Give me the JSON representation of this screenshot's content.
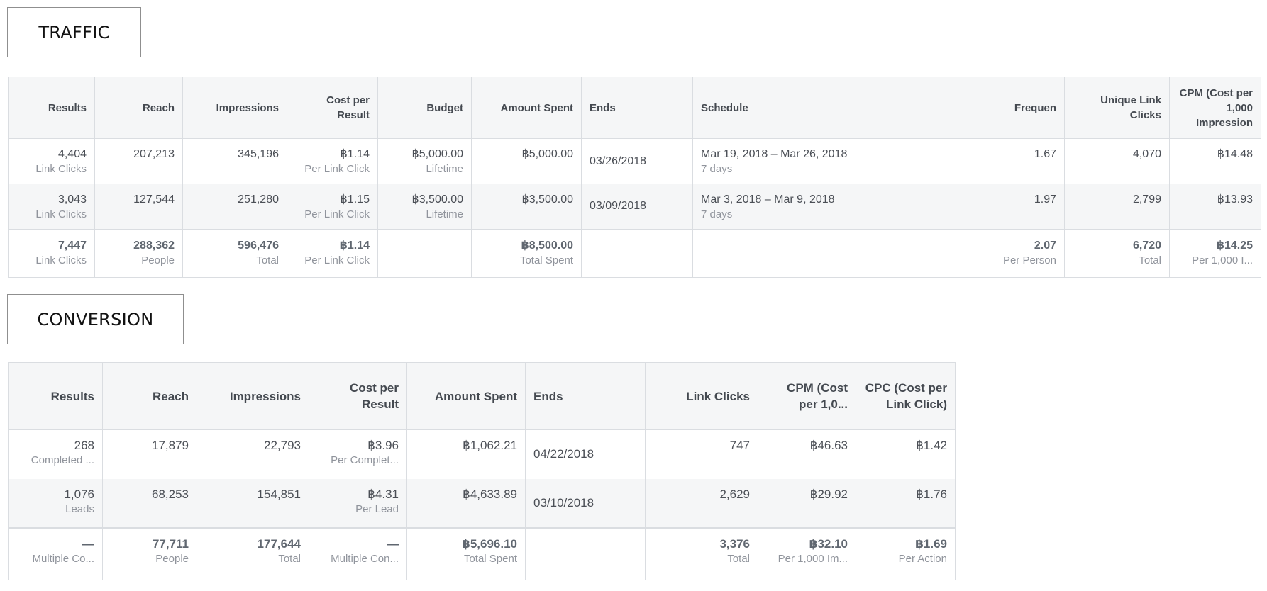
{
  "traffic": {
    "label": "TRAFFIC",
    "headers": [
      "Results",
      "Reach",
      "Impressions",
      "Cost per Result",
      "Budget",
      "Amount Spent",
      "Ends",
      "Schedule",
      "Frequen",
      "Unique Link Clicks",
      "CPM (Cost per 1,000 Impression"
    ],
    "rows": [
      {
        "results": "4,404",
        "results_sub": "Link Clicks",
        "reach": "207,213",
        "impressions": "345,196",
        "cost": "฿1.14",
        "cost_sub": "Per Link Click",
        "budget": "฿5,000.00",
        "budget_sub": "Lifetime",
        "spent": "฿5,000.00",
        "ends": "03/26/2018",
        "schedule": "Mar 19, 2018 – Mar 26, 2018",
        "schedule_sub": "7 days",
        "frequency": "1.67",
        "unique": "4,070",
        "cpm": "฿14.48"
      },
      {
        "results": "3,043",
        "results_sub": "Link Clicks",
        "reach": "127,544",
        "impressions": "251,280",
        "cost": "฿1.15",
        "cost_sub": "Per Link Click",
        "budget": "฿3,500.00",
        "budget_sub": "Lifetime",
        "spent": "฿3,500.00",
        "ends": "03/09/2018",
        "schedule": "Mar 3, 2018 – Mar 9, 2018",
        "schedule_sub": "7 days",
        "frequency": "1.97",
        "unique": "2,799",
        "cpm": "฿13.93"
      }
    ],
    "total": {
      "results": "7,447",
      "results_sub": "Link Clicks",
      "reach": "288,362",
      "reach_sub": "People",
      "impressions": "596,476",
      "impressions_sub": "Total",
      "cost": "฿1.14",
      "cost_sub": "Per Link Click",
      "spent": "฿8,500.00",
      "spent_sub": "Total Spent",
      "frequency": "2.07",
      "frequency_sub": "Per Person",
      "unique": "6,720",
      "unique_sub": "Total",
      "cpm": "฿14.25",
      "cpm_sub": "Per 1,000 I..."
    }
  },
  "conversion": {
    "label": "CONVERSION",
    "headers": [
      "Results",
      "Reach",
      "Impressions",
      "Cost per Result",
      "Amount Spent",
      "Ends",
      "Link Clicks",
      "CPM (Cost per 1,0...",
      "CPC (Cost per Link Click)"
    ],
    "rows": [
      {
        "results": "268",
        "results_sub": "Completed ...",
        "reach": "17,879",
        "impressions": "22,793",
        "cost": "฿3.96",
        "cost_sub": "Per Complet...",
        "spent": "฿1,062.21",
        "ends": "04/22/2018",
        "clicks": "747",
        "cpm": "฿46.63",
        "cpc": "฿1.42"
      },
      {
        "results": "1,076",
        "results_sub": "Leads",
        "reach": "68,253",
        "impressions": "154,851",
        "cost": "฿4.31",
        "cost_sub": "Per Lead",
        "spent": "฿4,633.89",
        "ends": "03/10/2018",
        "clicks": "2,629",
        "cpm": "฿29.92",
        "cpc": "฿1.76"
      }
    ],
    "total": {
      "results": "—",
      "results_sub": "Multiple Co...",
      "reach": "77,711",
      "reach_sub": "People",
      "impressions": "177,644",
      "impressions_sub": "Total",
      "cost": "—",
      "cost_sub": "Multiple Con...",
      "spent": "฿5,696.10",
      "spent_sub": "Total Spent",
      "clicks": "3,376",
      "clicks_sub": "Total",
      "cpm": "฿32.10",
      "cpm_sub": "Per 1,000 Im...",
      "cpc": "฿1.69",
      "cpc_sub": "Per Action"
    }
  }
}
